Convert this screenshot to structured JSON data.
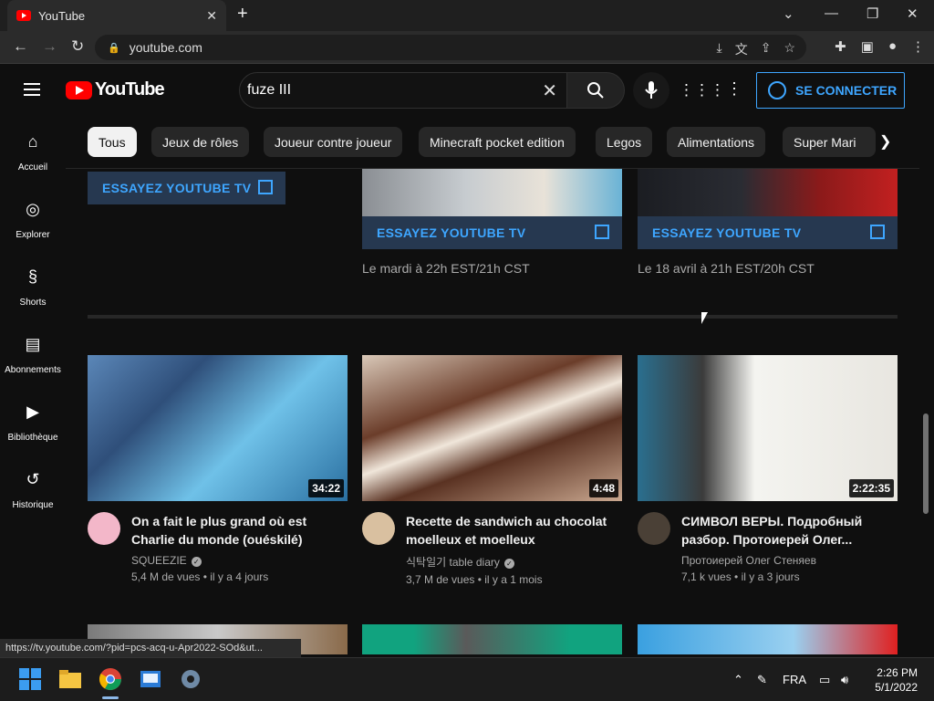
{
  "browser": {
    "tab_title": "YouTube",
    "url": "youtube.com",
    "status_url": "https://tv.youtube.com/?pid=pcs-acq-u-Apr2022-SOd&ut..."
  },
  "header": {
    "logo_text": "YouTube",
    "search_query": "fuze III",
    "signin_label": "SE CONNECTER"
  },
  "chips": [
    "Tous",
    "Jeux de rôles",
    "Joueur contre joueur",
    "Minecraft pocket edition",
    "Legos",
    "Alimentations",
    "Super Mari"
  ],
  "sidebar": {
    "items": [
      {
        "label": "Accueil",
        "icon": "home-icon"
      },
      {
        "label": "Explorer",
        "icon": "compass-icon"
      },
      {
        "label": "Shorts",
        "icon": "shorts-icon"
      },
      {
        "label": "Abonnements",
        "icon": "subscriptions-icon"
      },
      {
        "label": "Bibliothèque",
        "icon": "library-icon"
      },
      {
        "label": "Historique",
        "icon": "history-icon"
      }
    ]
  },
  "tv_promos": {
    "button_label": "ESSAYEZ YOUTUBE TV",
    "dates": [
      "Le mardi à 22h EST/21h CST",
      "Le 18 avril à 21h EST/20h CST"
    ]
  },
  "videos": [
    {
      "title": "On a fait le plus grand où est Charlie du monde (ouéskilé)",
      "channel": "SQUEEZIE",
      "verified": true,
      "views": "5,4 M de vues",
      "age": "il y a 4 jours",
      "duration": "34:22"
    },
    {
      "title": "Recette de sandwich au chocolat moelleux et moelleux",
      "channel": "식탁일기 table diary",
      "verified": true,
      "views": "3,7 M de vues",
      "age": "il y a 1 mois",
      "duration": "4:48"
    },
    {
      "title": "СИМВОЛ ВЕРЫ. Подробный разбор. Протоиерей Олег...",
      "channel": "Протоиерей Олег Стеняев",
      "verified": false,
      "views": "7,1 k vues",
      "age": "il y a 3 jours",
      "duration": "2:22:35"
    }
  ],
  "taskbar": {
    "language": "FRA",
    "time": "2:26 PM",
    "date": "5/1/2022"
  }
}
